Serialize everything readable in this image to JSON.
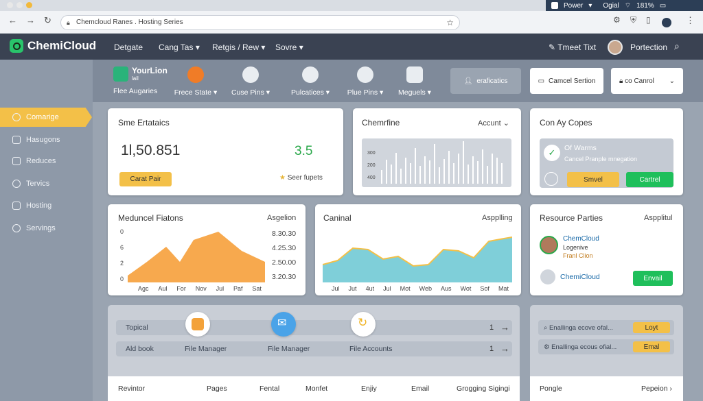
{
  "os_bar": {
    "menu_label": "Power",
    "status_text": "Ogial",
    "battery_text": "181%"
  },
  "browser": {
    "url": "Chemcloud Ranes . Hosting Series"
  },
  "nav": {
    "brand": "ChemiCloud",
    "links": [
      "Detgate",
      "Cang Tas",
      "Retgis / Rew",
      "Sovre"
    ],
    "search_label": "Tmeet Tixt",
    "user_label": "Portection"
  },
  "sidebar": {
    "items": [
      "Comarige",
      "Hasugons",
      "Reduces",
      "Tervics",
      "Hosting",
      "Servings"
    ]
  },
  "toolbar": {
    "account_title": "YourLion",
    "account_sub": "lail",
    "tools": [
      "Flee Augaries",
      "Frece State",
      "Cuse Pins",
      "Pulcatices",
      "Plue Pins",
      "Meguels"
    ],
    "btn_gray": "eraficatics",
    "btn_white1": "Camcel Sertion",
    "btn_white2": "co Canrol"
  },
  "card_stats": {
    "title": "Sme Ertataics",
    "big_number": "1l,50.851",
    "green_number": "3.5",
    "button": "Carat Pair",
    "link": "Seer fupets"
  },
  "card_chart1": {
    "title": "Chemrfine",
    "dropdown": "Accunt",
    "yticks": [
      "300",
      "200",
      "400"
    ]
  },
  "card_copes": {
    "title": "Con Ay Copes",
    "line1": "Of Warms",
    "line2": "Cancel Pranple mnegation",
    "btn_yellow": "Smvel",
    "btn_green": "Cartrel"
  },
  "card_area1": {
    "title": "Meduncel Fiatons",
    "side": "Asgelion",
    "yticks": [
      "0",
      "6",
      "2",
      "0"
    ],
    "values_right": [
      "8.30.30",
      "4.25.30",
      "2.50.00",
      "3.20.30"
    ],
    "xlabels": [
      "Agc",
      "Aul",
      "For",
      "Nov",
      "Jul",
      "Paf",
      "Sat"
    ]
  },
  "card_area2": {
    "title": "Caninal",
    "side": "Aspplling",
    "xlabels": [
      "Jul",
      "Jut",
      "4ut",
      "Jul",
      "Mot",
      "Web",
      "Aus",
      "Wot",
      "Sof",
      "Mat"
    ]
  },
  "card_resource": {
    "title": "Resource Parties",
    "side": "Aspplitul",
    "person_name": "ChemCloud",
    "person_role": "Logenive",
    "person_sub": "Franl Clion",
    "item2": "ChemiCloud",
    "button": "Envail"
  },
  "bottom": {
    "rows": [
      {
        "label": "Topical",
        "num": "1"
      },
      {
        "label": "Ald book",
        "num": "1"
      }
    ],
    "features": [
      "File Manager",
      "File Manager",
      "File Accounts"
    ],
    "right_rows": [
      {
        "text": "Enallinga ecove ofal...",
        "btn": "Loyt"
      },
      {
        "text": "Enallinga ecous ofial...",
        "btn": "Emal"
      }
    ]
  },
  "table": {
    "headers": [
      "Revintor",
      "Pages",
      "Fental",
      "Monfet",
      "Enjiy",
      "Email",
      "Grogging Sigingi"
    ],
    "right_header": "Pongle",
    "right_action": "Pepeion"
  },
  "colors": {
    "nav": "#3a4252",
    "accent_yellow": "#f3c048",
    "green": "#1fbf5b",
    "orange_area": "#f7a94e",
    "teal_area": "#7fcfd9"
  }
}
